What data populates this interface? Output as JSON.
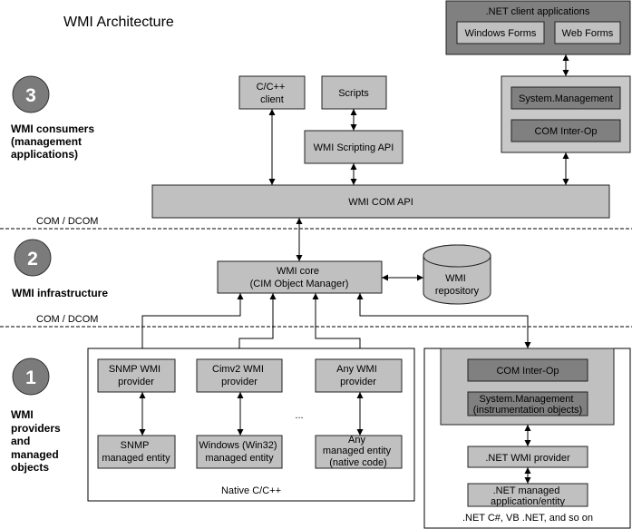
{
  "title": "WMI Architecture",
  "colors": {
    "box_light": "#c0c0c0",
    "box_dark": "#808080",
    "container_light": "#c8c8c8",
    "circle": "#7b7b7b",
    "line": "#000000",
    "background": "#ffffff"
  },
  "layers": [
    {
      "number": "3",
      "label_lines": [
        "WMI consumers",
        "(management",
        "applications)"
      ]
    },
    {
      "number": "2",
      "label_lines": [
        "WMI infrastructure"
      ]
    },
    {
      "number": "1",
      "label_lines": [
        "WMI",
        "providers",
        "and",
        "managed",
        "objects"
      ]
    }
  ],
  "separators": [
    "COM / DCOM",
    "COM / DCOM"
  ],
  "consumers": {
    "cpp_client": [
      "C/C++",
      "client"
    ],
    "scripts": "Scripts",
    "scripting_api": "WMI Scripting API",
    "dotnet_clients": {
      "title": ".NET client applications",
      "windows_forms": "Windows Forms",
      "web_forms": "Web Forms"
    },
    "system_management": "System.Management",
    "com_interop": "COM Inter-Op",
    "com_api": "WMI COM API"
  },
  "infrastructure": {
    "core": [
      "WMI core",
      "(CIM Object Manager)"
    ],
    "repository": [
      "WMI",
      "repository"
    ]
  },
  "providers": {
    "native": {
      "label": "Native C/C++",
      "ellipsis": "...",
      "providers": [
        [
          "SNMP WMI",
          "provider"
        ],
        [
          "Cimv2 WMI",
          "provider"
        ],
        [
          "Any WMI",
          "provider"
        ]
      ],
      "entities": [
        [
          "SNMP",
          "managed entity"
        ],
        [
          "Windows (Win32)",
          "managed entity"
        ],
        [
          "Any",
          "managed entity",
          "(native code)"
        ]
      ]
    },
    "dotnet": {
      "label": ".NET C#, VB .NET, and so on",
      "com_interop": "COM Inter-Op",
      "system_management": [
        "System.Management",
        "(instrumentation objects)"
      ],
      "wmi_provider": ".NET WMI provider",
      "managed_entity": [
        ".NET managed",
        "application/entity"
      ]
    }
  },
  "connections": [
    {
      "from": ".NET client applications",
      "to": "System.Management",
      "bidirectional": true
    },
    {
      "from": "System.Management",
      "to": "WMI COM API",
      "bidirectional": true
    },
    {
      "from": "C/C++ client",
      "to": "WMI COM API",
      "bidirectional": true
    },
    {
      "from": "Scripts",
      "to": "WMI Scripting API",
      "bidirectional": true
    },
    {
      "from": "WMI Scripting API",
      "to": "WMI COM API",
      "bidirectional": true
    },
    {
      "from": "WMI COM API",
      "to": "WMI core",
      "bidirectional": true
    },
    {
      "from": "WMI core",
      "to": "WMI repository",
      "bidirectional": true
    },
    {
      "from": "WMI core",
      "to": "SNMP WMI provider",
      "bidirectional": true
    },
    {
      "from": "WMI core",
      "to": "Cimv2 WMI provider",
      "bidirectional": true
    },
    {
      "from": "WMI core",
      "to": "Any WMI provider",
      "bidirectional": true
    },
    {
      "from": "WMI core",
      "to": ".NET COM Inter-Op",
      "bidirectional": true
    },
    {
      "from": "SNMP WMI provider",
      "to": "SNMP managed entity",
      "bidirectional": true
    },
    {
      "from": "Cimv2 WMI provider",
      "to": "Windows (Win32) managed entity",
      "bidirectional": true
    },
    {
      "from": "Any WMI provider",
      "to": "Any managed entity",
      "bidirectional": true
    },
    {
      "from": "System.Management (instrumentation objects)",
      "to": ".NET WMI provider",
      "bidirectional": true
    },
    {
      "from": ".NET WMI provider",
      "to": ".NET managed application/entity",
      "bidirectional": true
    }
  ]
}
